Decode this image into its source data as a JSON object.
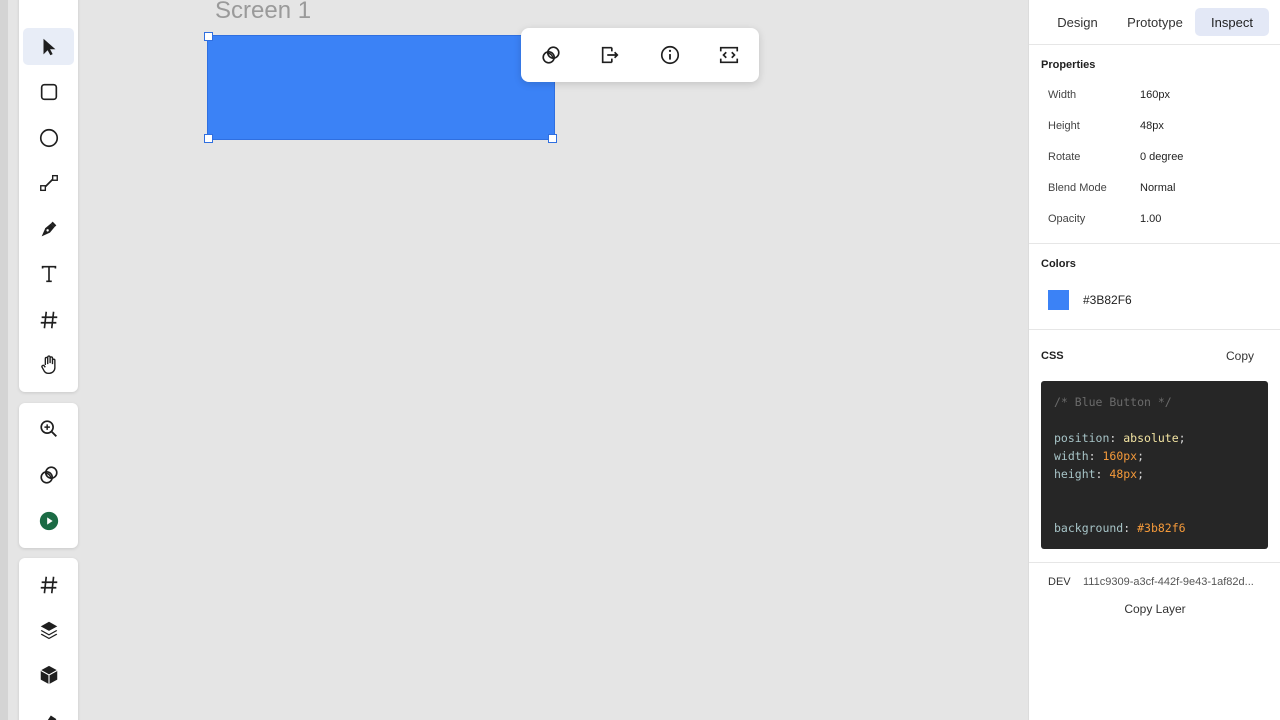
{
  "canvas": {
    "screen_label": "Screen 1",
    "shape_color": "#3B82F6"
  },
  "left_toolbar": {
    "groups": [
      [
        "move-tool",
        "rectangle-tool",
        "ellipse-tool",
        "line-tool",
        "pen-tool",
        "text-tool",
        "frame-tool",
        "hand-tool"
      ],
      [
        "zoom-tool",
        "boolean-tool",
        "play-tool"
      ],
      [
        "grid-tool",
        "layers-tool",
        "component-tool"
      ]
    ],
    "active": "move-tool"
  },
  "floating_toolbar": {
    "icons": [
      "link-icon",
      "export-icon",
      "info-icon",
      "code-icon"
    ]
  },
  "panel": {
    "tabs": [
      "Design",
      "Prototype",
      "Inspect"
    ],
    "active_tab": "Inspect",
    "properties_title": "Properties",
    "properties": [
      {
        "label": "Width",
        "value": "160px"
      },
      {
        "label": "Height",
        "value": "48px"
      },
      {
        "label": "Rotate",
        "value": "0 degree"
      },
      {
        "label": "Blend Mode",
        "value": "Normal"
      },
      {
        "label": "Opacity",
        "value": "1.00"
      }
    ],
    "colors_title": "Colors",
    "color_value": "#3B82F6",
    "css_title": "CSS",
    "copy_label": "Copy",
    "css_code": {
      "comment": "/* Blue Button */",
      "lines": [
        {
          "prop": "position",
          "value": "absolute",
          "kind": "kw"
        },
        {
          "prop": "width",
          "value": "160px",
          "kind": "num"
        },
        {
          "prop": "height",
          "value": "48px",
          "kind": "num"
        },
        {
          "prop": "background",
          "value": "#3b82f6",
          "kind": "num"
        }
      ]
    },
    "dev_label": "DEV",
    "dev_id": "111c9309-a3cf-442f-9e43-1af82d...",
    "copy_layer_label": "Copy Layer"
  }
}
